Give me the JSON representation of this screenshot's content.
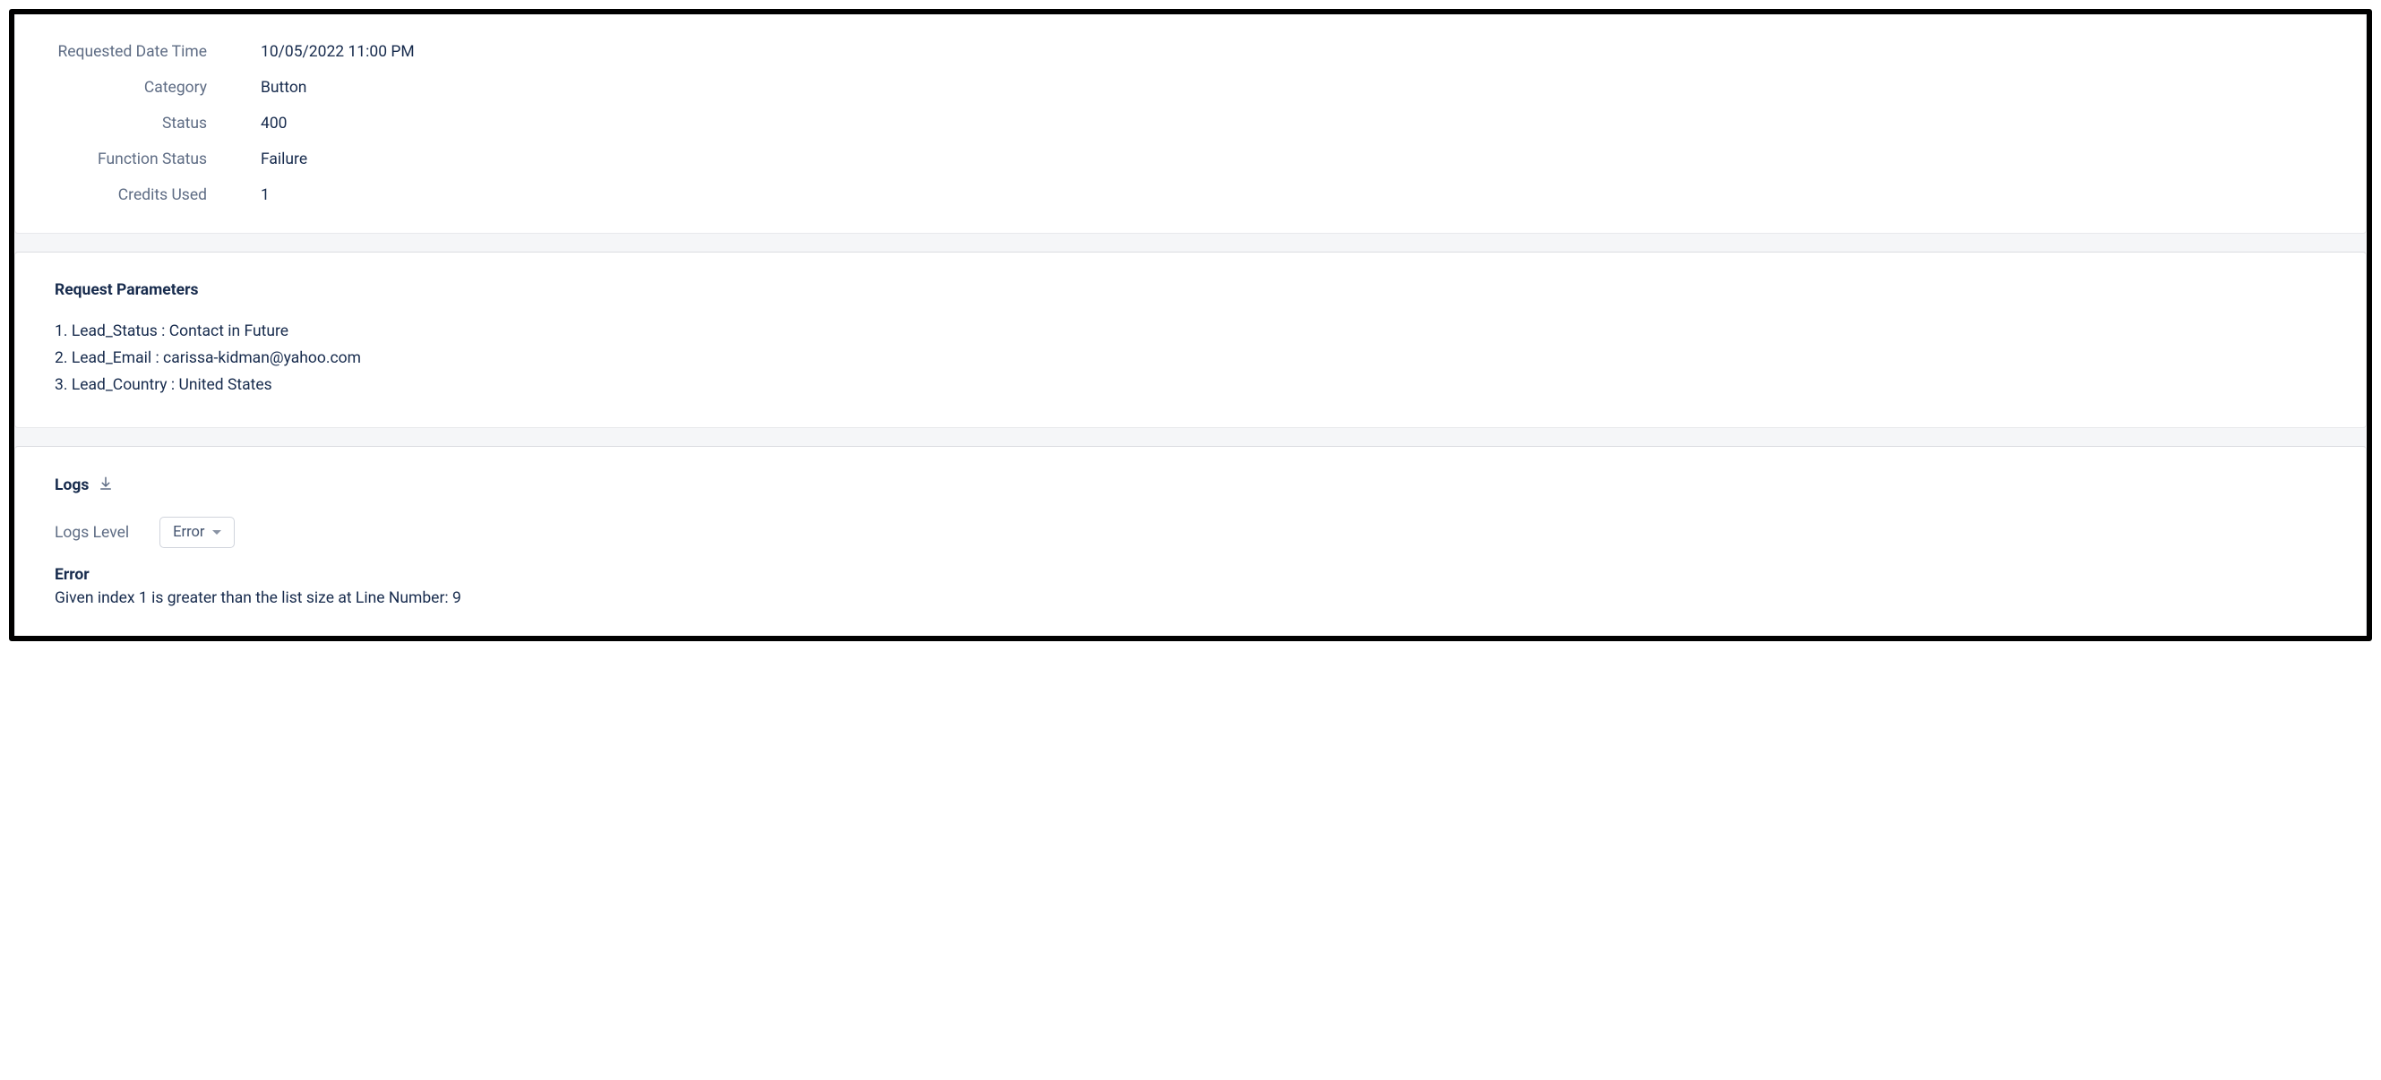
{
  "details": {
    "requestedDateTime": {
      "label": "Requested Date Time",
      "value": "10/05/2022 11:00 PM"
    },
    "category": {
      "label": "Category",
      "value": "Button"
    },
    "status": {
      "label": "Status",
      "value": "400"
    },
    "functionStatus": {
      "label": "Function Status",
      "value": "Failure"
    },
    "creditsUsed": {
      "label": "Credits Used",
      "value": "1"
    }
  },
  "requestParams": {
    "title": "Request Parameters",
    "items": [
      "Lead_Status : Contact in Future",
      "Lead_Email : carissa-kidman@yahoo.com",
      "Lead_Country : United States"
    ]
  },
  "logs": {
    "title": "Logs",
    "levelLabel": "Logs Level",
    "levelSelected": "Error",
    "errorHeading": "Error",
    "errorMessage": "Given index 1 is greater than the list size at Line Number: 9"
  }
}
